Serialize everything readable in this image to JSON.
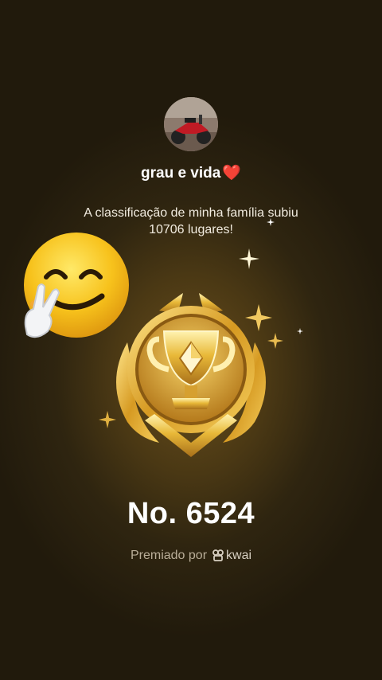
{
  "profile": {
    "username": "grau e vida",
    "heart": "❤️"
  },
  "announcement": {
    "line1": "A classificação de minha família subiu",
    "line2": "10706 lugares!"
  },
  "rank": {
    "label": "No. 6524"
  },
  "footer": {
    "awarded_by": "Premiado por",
    "brand": "kwai"
  },
  "icons": [
    "avatar-photo",
    "smiling-victory-emoji",
    "gold-trophy-medal-icon",
    "sparkle-icon",
    "kwai-logo-icon"
  ],
  "colors": {
    "background": "#2f2510",
    "gold": "#e0b040",
    "heart": "#e0191f"
  }
}
